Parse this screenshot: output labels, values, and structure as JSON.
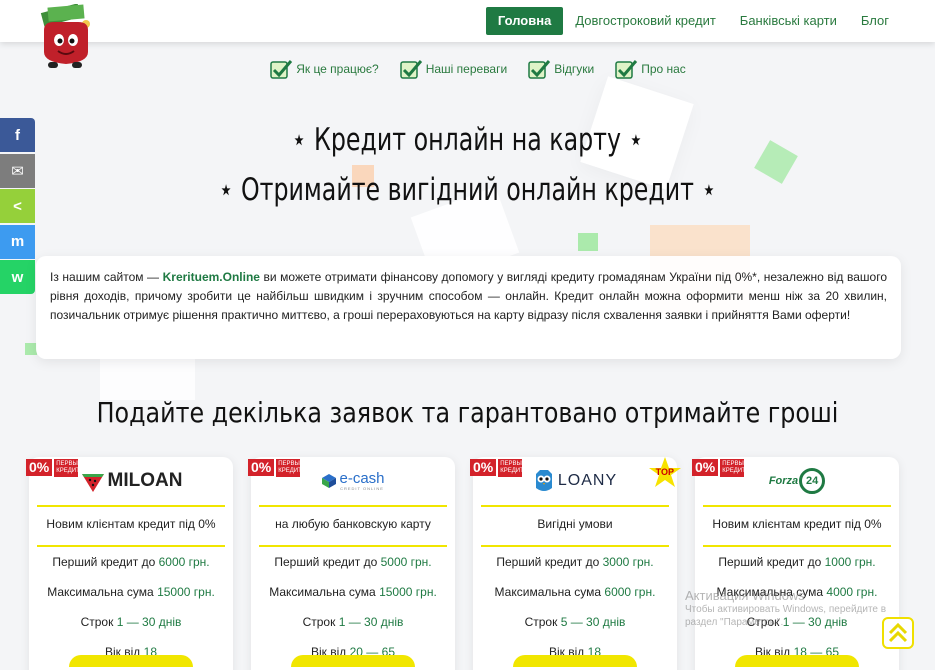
{
  "nav": {
    "items": [
      "Головна",
      "Довгостроковий кредит",
      "Банківські карти",
      "Блог"
    ],
    "active_index": 0
  },
  "subnav": [
    "Як це працює?",
    "Наші переваги",
    "Відгуки",
    "Про нас"
  ],
  "hero": {
    "line1": "⋆ Кредит онлайн на карту ⋆",
    "line2": "⋆ Отримайте вигідний онлайн кредит ⋆"
  },
  "intro": {
    "before": "Із нашим сайтом — ",
    "brand": "Krerituem.Online",
    "after": " ви можете отримати фінансову допомогу у вигляді кредиту громадянам України під 0%*, незалежно від вашого рівня доходів, причому зробити це найбільш швидким і зручним способом — онлайн. Кредит онлайн можна оформити менш ніж за 20 хвилин, позичальник отримує рішення практично миттєво, а гроші перераховуються на карту відразу після схвалення заявки і прийняття Вами оферти!"
  },
  "section_title": "Подайте декілька заявок та гарантовано отримайте гроші",
  "share": [
    "f",
    "✉",
    "<",
    "m",
    "w"
  ],
  "cards": [
    {
      "brand": "MILOAN",
      "badge": "0%",
      "badge_small": "ПЕРВЫЙ КРЕДИТ",
      "tagline": "Новим клієнтам кредит під 0%",
      "first_label": "Перший кредит до",
      "first_value": "6000 грн.",
      "max_label": "Максимальна сума",
      "max_value": "15000 грн.",
      "term_label": "Строк",
      "term_value": "1 — 30 днів",
      "age_label": "Вік від",
      "age_value": "18"
    },
    {
      "brand": "e-cash",
      "brand_sub": "CREDIT ONLINE",
      "badge": "0%",
      "badge_small": "ПЕРВЫЙ КРЕДИТ",
      "tagline": "на любую банковскую карту",
      "first_label": "Перший кредит до",
      "first_value": "5000 грн.",
      "max_label": "Максимальна сума",
      "max_value": "15000 грн.",
      "term_label": "Строк",
      "term_value": "1 — 30 днів",
      "age_label": "Вік від",
      "age_value": "20 — 65"
    },
    {
      "brand": "LOANY",
      "badge": "0%",
      "badge_small": "ПЕРВЫЙ КРЕДИТ",
      "top_label": "TOP",
      "tagline": "Вигідні умови",
      "first_label": "Перший кредит до",
      "first_value": "3000 грн.",
      "max_label": "Максимальна сума",
      "max_value": "6000 грн.",
      "term_label": "Строк",
      "term_value": "5 — 30 днів",
      "age_label": "Вік від",
      "age_value": "18"
    },
    {
      "brand": "Forza",
      "brand_num": "24",
      "badge": "0%",
      "badge_small": "ПЕРВЫЙ КРЕДИТ",
      "tagline": "Новим клієнтам кредит під 0%",
      "first_label": "Перший кредит до",
      "first_value": "1000 грн.",
      "max_label": "Максимальна сума",
      "max_value": "4000 грн.",
      "term_label": "Строк",
      "term_value": "1 — 30 днів",
      "age_label": "Вік від",
      "age_value": "18 — 65"
    }
  ],
  "watermark": {
    "title": "Активация Windows",
    "line1": "Чтобы активировать Windows, перейдите в",
    "line2": "раздел \"Параметры\"."
  },
  "colors": {
    "accent": "#1f7a43",
    "yellow": "#f1e600",
    "badge_red": "#d3222a"
  }
}
